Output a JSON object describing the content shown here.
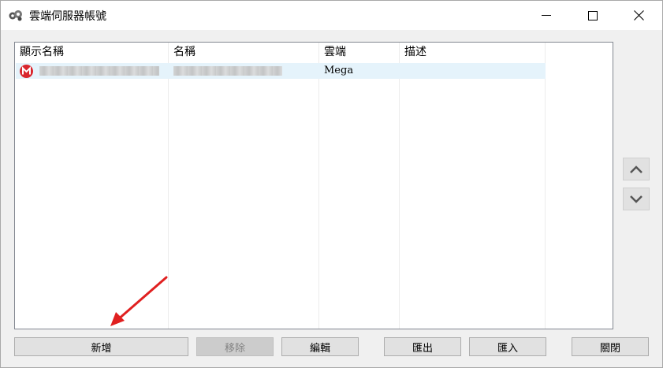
{
  "window": {
    "title": "雲端伺服器帳號",
    "icon": "cloud-gears-icon"
  },
  "table": {
    "columns": [
      "顯示名稱",
      "名稱",
      "雲端",
      "描述"
    ],
    "rows": [
      {
        "icon": "mega-icon",
        "display_name": "",
        "name": "",
        "cloud": "Mega",
        "description": ""
      }
    ]
  },
  "buttons": {
    "add": "新增",
    "remove": "移除",
    "edit": "編輯",
    "export": "匯出",
    "import": "匯入",
    "close": "關閉"
  },
  "colors": {
    "selected_row": "#e5f3fb",
    "mega_red": "#d9272e",
    "arrow_red": "#e02020"
  }
}
